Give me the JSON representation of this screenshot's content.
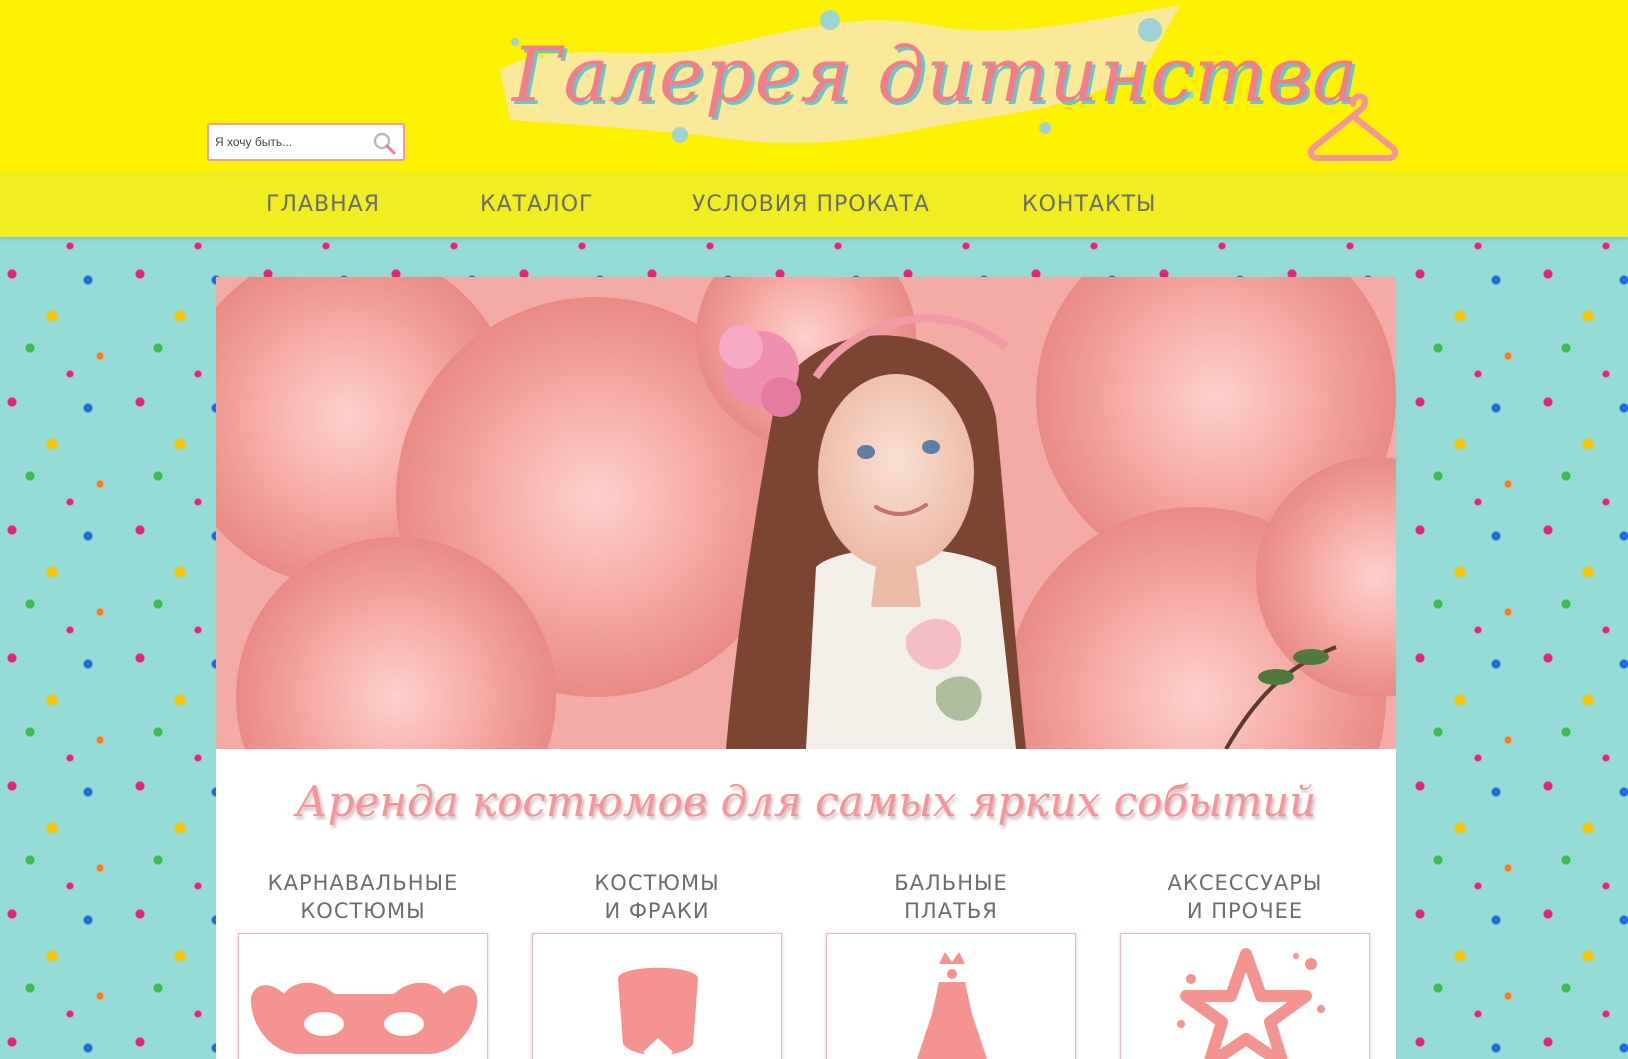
{
  "header": {
    "logo_text": "Галерея дитинства",
    "search": {
      "placeholder": "Я хочу быть...",
      "button_icon": "search-icon"
    },
    "cart_icon": "hanger-icon"
  },
  "nav": {
    "items": [
      {
        "label": "ГЛАВНАЯ"
      },
      {
        "label": "КАТАЛОГ"
      },
      {
        "label": "УСЛОВИЯ ПРОКАТА"
      },
      {
        "label": "КОНТАКТЫ"
      }
    ]
  },
  "hero": {
    "image_subject": "hero-photo"
  },
  "main": {
    "tagline": "Аренда костюмов для самых ярких событий",
    "categories": [
      {
        "title": "КАРНАВАЛЬНЫЕ\nКОСТЮМЫ",
        "icon": "mask-icon"
      },
      {
        "title": "КОСТЮМЫ\nИ ФРАКИ",
        "icon": "tuxedo-icon"
      },
      {
        "title": "БАЛЬНЫЕ\nПЛАТЬЯ",
        "icon": "ball-dress-icon"
      },
      {
        "title": "АКСЕССУАРЫ\nИ ПРОЧЕЕ",
        "icon": "star-icon"
      }
    ]
  },
  "colors": {
    "header_bg": "#fff200",
    "nav_bg": "#f0ee20",
    "page_bg": "#96dad6",
    "accent_pink": "#f4949b",
    "nav_text": "#6c6b70"
  }
}
